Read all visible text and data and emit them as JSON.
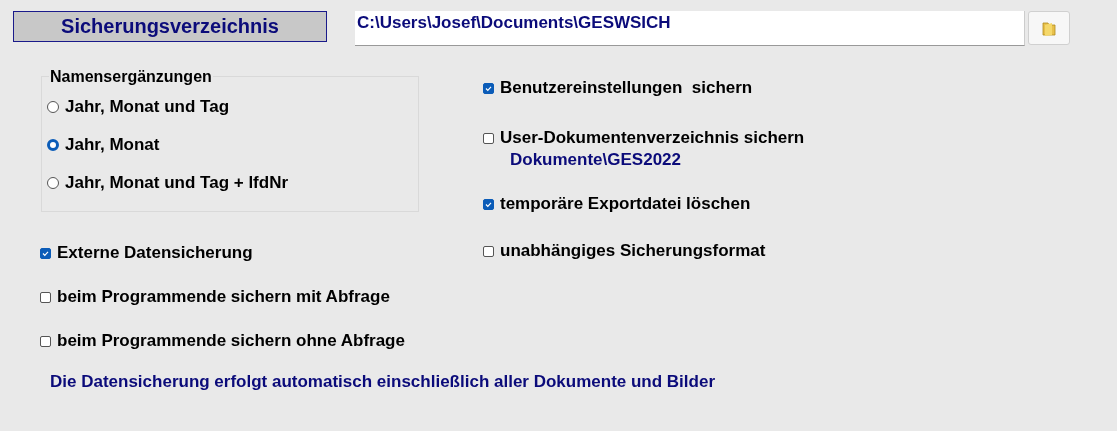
{
  "directory": {
    "label": "Sicherungsverzeichnis",
    "path": "C:\\Users\\Josef\\Documents\\GESWSICH"
  },
  "name_suffix": {
    "title": "Namensergänzungen",
    "options": [
      {
        "label": "Jahr, Monat und Tag",
        "selected": false
      },
      {
        "label": "Jahr, Monat",
        "selected": true
      },
      {
        "label": "Jahr, Monat und Tag + lfdNr",
        "selected": false
      }
    ]
  },
  "left_options": [
    {
      "label": "Externe Datensicherung",
      "checked": true
    },
    {
      "label": "beim Programmende sichern mit Abfrage",
      "checked": false
    },
    {
      "label": "beim Programmende sichern ohne Abfrage",
      "checked": false
    }
  ],
  "right_options": [
    {
      "label": "Benutzereinstellungen  sichern",
      "checked": true
    },
    {
      "label": "User-Dokumentenverzeichnis sichern",
      "checked": false,
      "detail": "Dokumente\\GES2022"
    },
    {
      "label": "temporäre Exportdatei löschen",
      "checked": true
    },
    {
      "label": "unabhängiges Sicherungsformat",
      "checked": false
    }
  ],
  "note": "Die Datensicherung erfolgt automatisch einschließlich aller Dokumente und Bilder"
}
